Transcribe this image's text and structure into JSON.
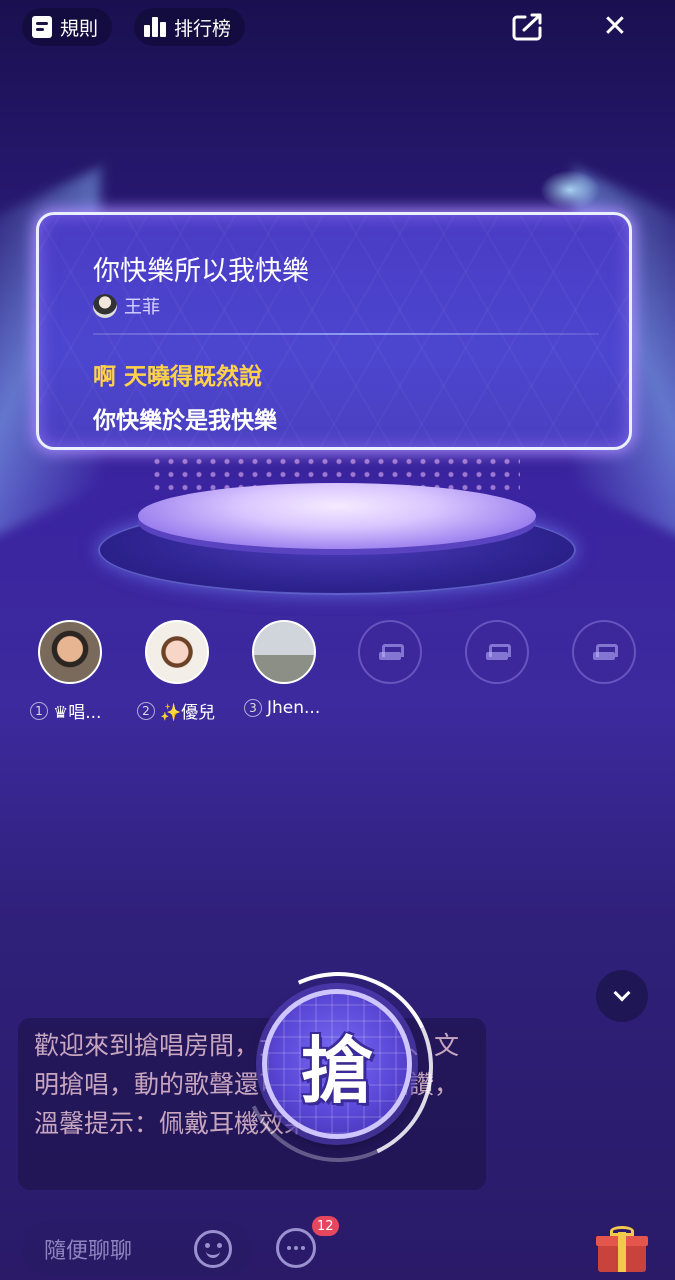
{
  "topbar": {
    "rules_label": "規則",
    "rank_label": "排行榜",
    "icons": [
      "rules-icon",
      "rank-icon",
      "share-icon",
      "close-icon"
    ]
  },
  "song": {
    "title": "你快樂所以我快樂",
    "artist": "王菲",
    "current_line": "啊 天曉得既然說",
    "next_line": "你快樂於是我快樂"
  },
  "seats": [
    {
      "num": "1",
      "name": "♛唱..."
    },
    {
      "num": "2",
      "name": "✨優兒"
    },
    {
      "num": "3",
      "name": "Jhen..."
    }
  ],
  "welcome": {
    "text": "歡迎來到搶唱房間，大家歡樂搶唱、文明搶唱，動的歌聲還可以送禮和點讚，溫馨提示：佩戴耳機效果最佳"
  },
  "grab_button": {
    "label": "搶"
  },
  "bottom": {
    "chat_placeholder": "隨便聊聊",
    "message_badge": "12"
  },
  "colors": {
    "accent_yellow": "#ffd24a",
    "badge_red": "#e5475e",
    "card_bg": "#4c46cf"
  }
}
